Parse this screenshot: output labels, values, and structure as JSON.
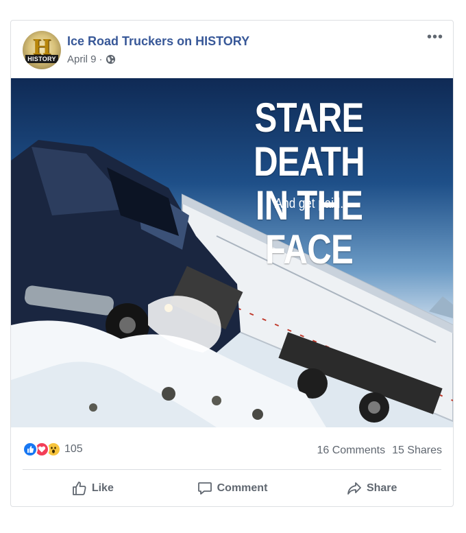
{
  "post": {
    "page_name": "Ice Road Truckers on HISTORY",
    "date": "April 9",
    "separator": "·",
    "privacy_icon": "globe-icon",
    "avatar": {
      "letter": "H",
      "label": "HISTORY"
    },
    "more_icon": "more-options-icon",
    "more_label": "•••"
  },
  "image": {
    "headline_line1": "STARE DEATH",
    "headline_line2": "IN THE FACE",
    "subline": "And get paid."
  },
  "stats": {
    "reactions": [
      "like-reaction-icon",
      "love-reaction-icon",
      "wow-reaction-icon"
    ],
    "reaction_count": "105",
    "comments": "16 Comments",
    "shares": "15 Shares"
  },
  "actions": {
    "like": "Like",
    "comment": "Comment",
    "share": "Share"
  },
  "colors": {
    "link_blue": "#385898",
    "meta_gray": "#606770",
    "like_blue": "#1877f2",
    "love_red": "#f33e58",
    "wow_yellow": "#f7c43d"
  }
}
